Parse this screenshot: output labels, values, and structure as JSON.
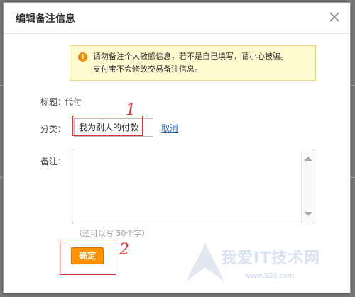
{
  "dialog": {
    "title": "编辑备注信息"
  },
  "notice": {
    "line1": "请勿备注个人敏感信息，若不是自己填写，请小心被骗。",
    "line2": "支付宝不会修改交易备注信息。"
  },
  "form": {
    "title_label": "标题：",
    "title_value": "代付",
    "category_label": "分类：",
    "category_value": "我为别人的付款",
    "cancel_link": "取消",
    "remark_label": "备注：",
    "remark_value": "",
    "char_hint": "（还可以写 50个字）",
    "confirm_button": "确定"
  },
  "annotations": {
    "mark1": "1",
    "mark2": "2"
  },
  "watermark": {
    "text": "我爱IT技术网",
    "url": "www.52ij.com"
  },
  "colors": {
    "accent_button": "#ff9200",
    "link": "#1a62b4",
    "notice_bg": "#fffbd0",
    "annotation": "#e03030"
  }
}
